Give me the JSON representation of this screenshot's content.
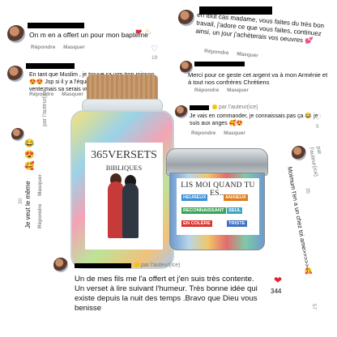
{
  "comments": [
    {
      "text": "On m en a offert un pour mon baptême",
      "emoji": "❤️🔥",
      "actions": [
        "Répondre",
        "Masquer"
      ],
      "likes": "19"
    },
    {
      "text": "En tant que Muslim , je trouve sa vrm trop mignon 😍😍 Jsp si il y a l'équivalent pour l'islam en en vente mais sa serais vrm bien !",
      "actions": [
        "Répondre",
        "Masquer"
      ]
    },
    {
      "text": "en tout cas madame, vous faites du très bon travail, j'adore ce que vous faites, continuez ainsi, un jour j'achèterais vos oeuvres 💕",
      "actions": [
        "Répondre",
        "Masquer"
      ]
    },
    {
      "text": "Merci pour ce geste cet argent va à mon Arménie et à tout nos confrères Chrétiens",
      "actions": [
        "Répondre",
        "Masquer"
      ]
    },
    {
      "text": "Je vais en commander, je connaissais pas ça 😂 je suis aux anges 🥰😍",
      "author_tag": "par l'auteur(ice)",
      "actions": [
        "Répondre",
        "Masquer"
      ],
      "likes": "5"
    },
    {
      "text": "Moimum t'en a un chez toi ame>>>>>🥰",
      "author_tag": "par l'auteur(ice)",
      "actions": [
        "Répondre",
        "Masquer"
      ],
      "likes": "35"
    },
    {
      "text": "Je veut le même",
      "author_tag": "par l'auteur(ice)",
      "actions": [
        "Répondre",
        "Masquer"
      ],
      "likes": "30"
    },
    {
      "text": "Un de mes fils me l'a offert et j'en suis très contente. Un verset à lire suivant l'humeur. Très bonne idée qui existe depuis la nuit des temps .Bravo que Dieu vous benisse",
      "author_tag": "par l'auteur(ice)",
      "likes": "344",
      "likes2": "57"
    }
  ],
  "jar": {
    "title": "365VERSETS",
    "subtitle": "BIBLIQUES"
  },
  "tin": {
    "title": "LIS MOI QUAND TU ES...",
    "moods": [
      {
        "label": "HEUREUX",
        "color": "#3a8fd6"
      },
      {
        "label": "ANXIEUX",
        "color": "#e07b1d"
      },
      {
        "label": "RECONNAISSANT",
        "color": "#3aa655"
      },
      {
        "label": "SEUL",
        "color": "#3aa6c8"
      },
      {
        "label": "EN COLÈRE",
        "color": "#d9352e"
      },
      {
        "label": "TRISTE",
        "color": "#3d6fc2"
      }
    ]
  },
  "colors": {
    "heart": "#e3213a",
    "meta": "#8a8a8a"
  }
}
